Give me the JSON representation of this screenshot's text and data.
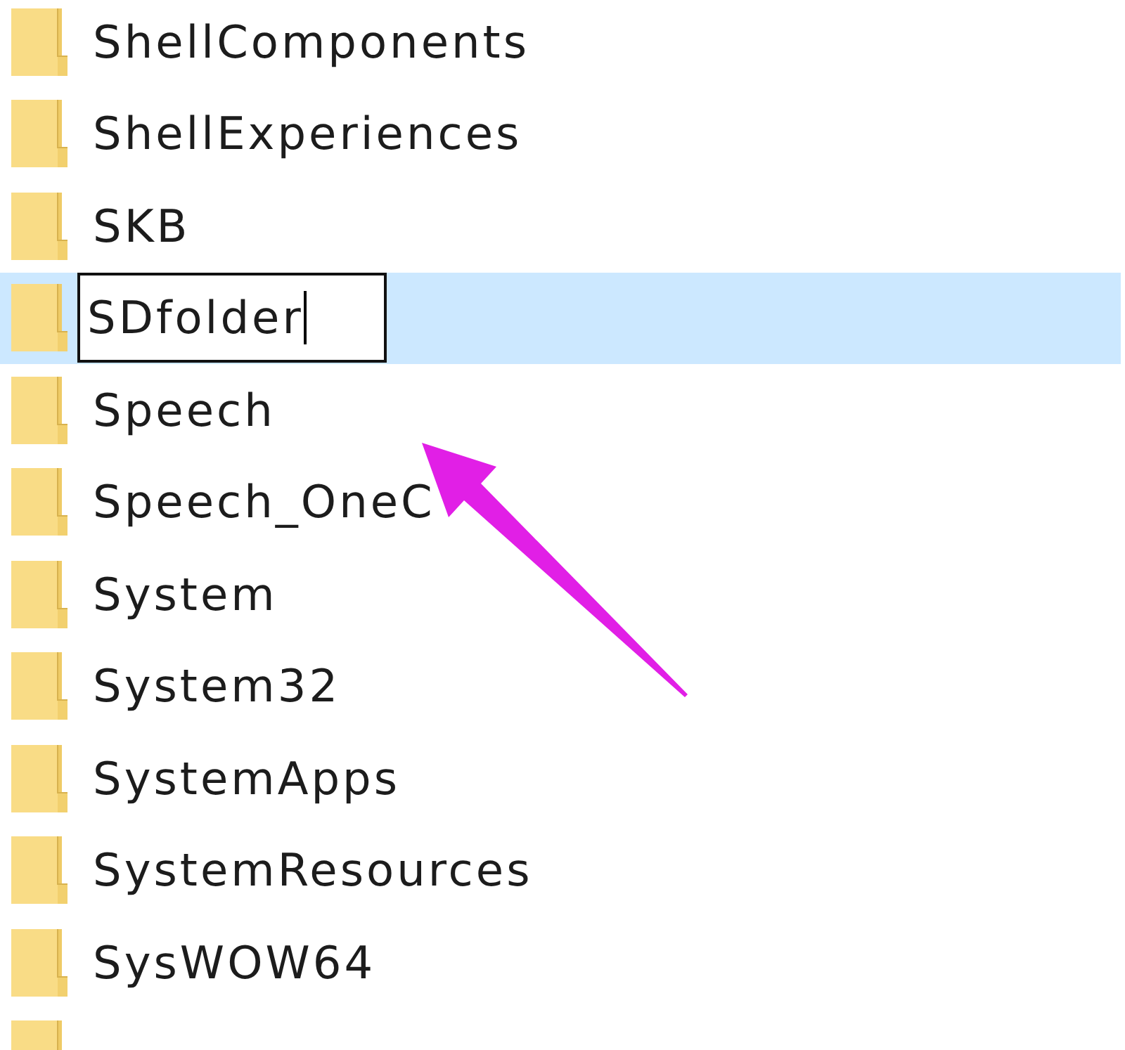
{
  "file_list": {
    "items": [
      {
        "name": "ShellComponents",
        "selected": false,
        "renaming": false
      },
      {
        "name": "ShellExperiences",
        "selected": false,
        "renaming": false
      },
      {
        "name": "SKB",
        "selected": false,
        "renaming": false
      },
      {
        "name": "SDfolder",
        "selected": true,
        "renaming": true
      },
      {
        "name": "Speech",
        "selected": false,
        "renaming": false
      },
      {
        "name": "Speech_OneC",
        "selected": false,
        "renaming": false
      },
      {
        "name": "System",
        "selected": false,
        "renaming": false
      },
      {
        "name": "System32",
        "selected": false,
        "renaming": false
      },
      {
        "name": "SystemApps",
        "selected": false,
        "renaming": false
      },
      {
        "name": "SystemResources",
        "selected": false,
        "renaming": false
      },
      {
        "name": "SysWOW64",
        "selected": false,
        "renaming": false
      },
      {
        "selected": false
      }
    ]
  }
}
